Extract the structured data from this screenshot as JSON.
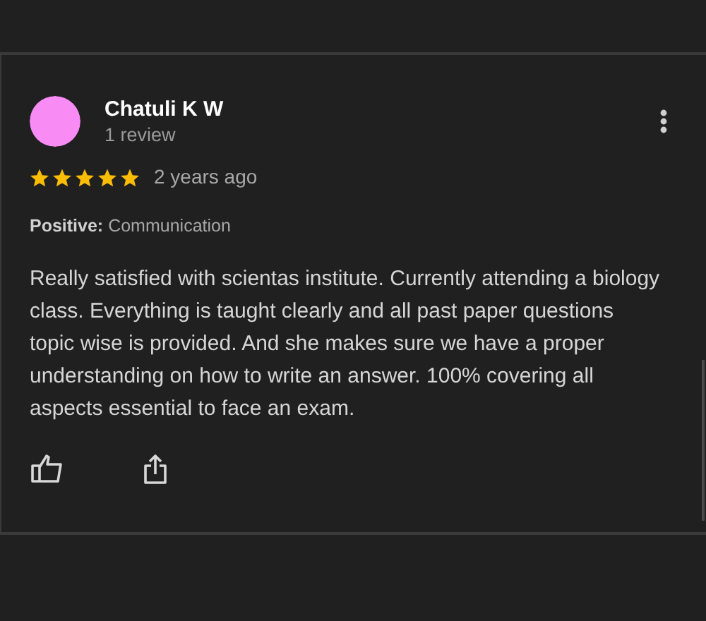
{
  "review": {
    "author": "Chatuli K W",
    "review_count": "1 review",
    "stars": 5,
    "time": "2 years ago",
    "highlights": "**Positive:** Communication",
    "text": "Really satisfied with scientas institute. Currently attending a biology class. Everything is taught clearly and all past paper questions topic wise is provided. And she makes sure we have a proper understanding on how to write an answer. 100% covering all aspects essential to face an exam."
  }
}
